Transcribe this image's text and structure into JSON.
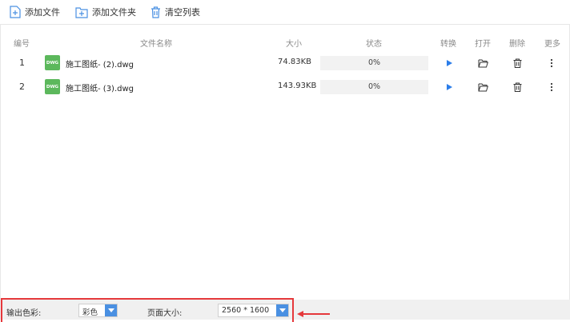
{
  "toolbar": {
    "add_file": "添加文件",
    "add_folder": "添加文件夹",
    "clear_list": "清空列表"
  },
  "table": {
    "headers": {
      "num": "编号",
      "name": "文件名称",
      "size": "大小",
      "status": "状态",
      "convert": "转换",
      "open": "打开",
      "delete": "删除",
      "more": "更多"
    },
    "rows": [
      {
        "num": "1",
        "icon": "DWG",
        "name": "施工图纸- (2).dwg",
        "size": "74.83KB",
        "progress": "0%",
        "progress_value": 0
      },
      {
        "num": "2",
        "icon": "DWG",
        "name": "施工图纸- (3).dwg",
        "size": "143.93KB",
        "progress": "0%",
        "progress_value": 0
      }
    ]
  },
  "settings": {
    "output_color_label": "输出色彩:",
    "output_color_value": "彩色",
    "page_size_label": "页面大小:",
    "page_size_value": "2560 * 1600"
  },
  "colors": {
    "accent": "#4a90e2",
    "file_icon": "#5cb85c",
    "highlight": "#e5383b"
  }
}
